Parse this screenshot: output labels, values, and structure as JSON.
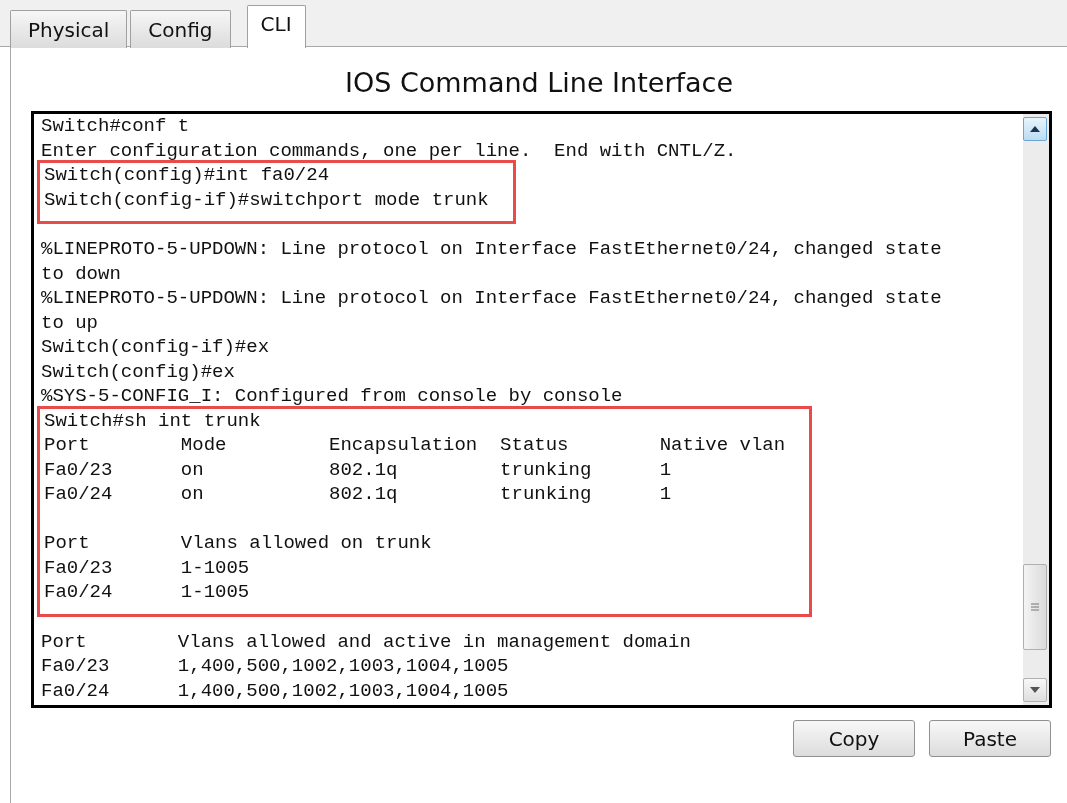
{
  "tabs": [
    {
      "label": "Physical",
      "selected": false
    },
    {
      "label": "Config",
      "selected": false
    },
    {
      "label": "CLI",
      "selected": true
    }
  ],
  "title": "IOS Command Line Interface",
  "terminal": {
    "blocks": [
      {
        "highlighted": false,
        "paragraphs": [
          [
            "Switch#conf t",
            "Enter configuration commands, one per line.  End with CNTL/Z."
          ]
        ]
      },
      {
        "highlighted": true,
        "paragraphs": [
          [
            "Switch(config)#int fa0/24",
            "Switch(config-if)#switchport mode trunk"
          ]
        ]
      },
      {
        "highlighted": false,
        "paragraphs": [
          [
            "%LINEPROTO-5-UPDOWN: Line protocol on Interface FastEthernet0/24, changed state",
            "to down",
            "%LINEPROTO-5-UPDOWN: Line protocol on Interface FastEthernet0/24, changed state",
            "to up",
            "Switch(config-if)#ex",
            "Switch(config)#ex",
            "%SYS-5-CONFIG_I: Configured from console by console"
          ]
        ]
      },
      {
        "highlighted": true,
        "paragraphs": [
          [
            "Switch#sh int trunk",
            "Port        Mode         Encapsulation  Status        Native vlan",
            "Fa0/23      on           802.1q         trunking      1",
            "Fa0/24      on           802.1q         trunking      1"
          ],
          [
            "Port        Vlans allowed on trunk",
            "Fa0/23      1-1005",
            "Fa0/24      1-1005"
          ]
        ]
      },
      {
        "highlighted": false,
        "paragraphs": [
          [
            "Port        Vlans allowed and active in management domain",
            "Fa0/23      1,400,500,1002,1003,1004,1005",
            "Fa0/24      1,400,500,1002,1003,1004,1005"
          ]
        ]
      }
    ]
  },
  "buttons": [
    "Copy",
    "Paste"
  ]
}
